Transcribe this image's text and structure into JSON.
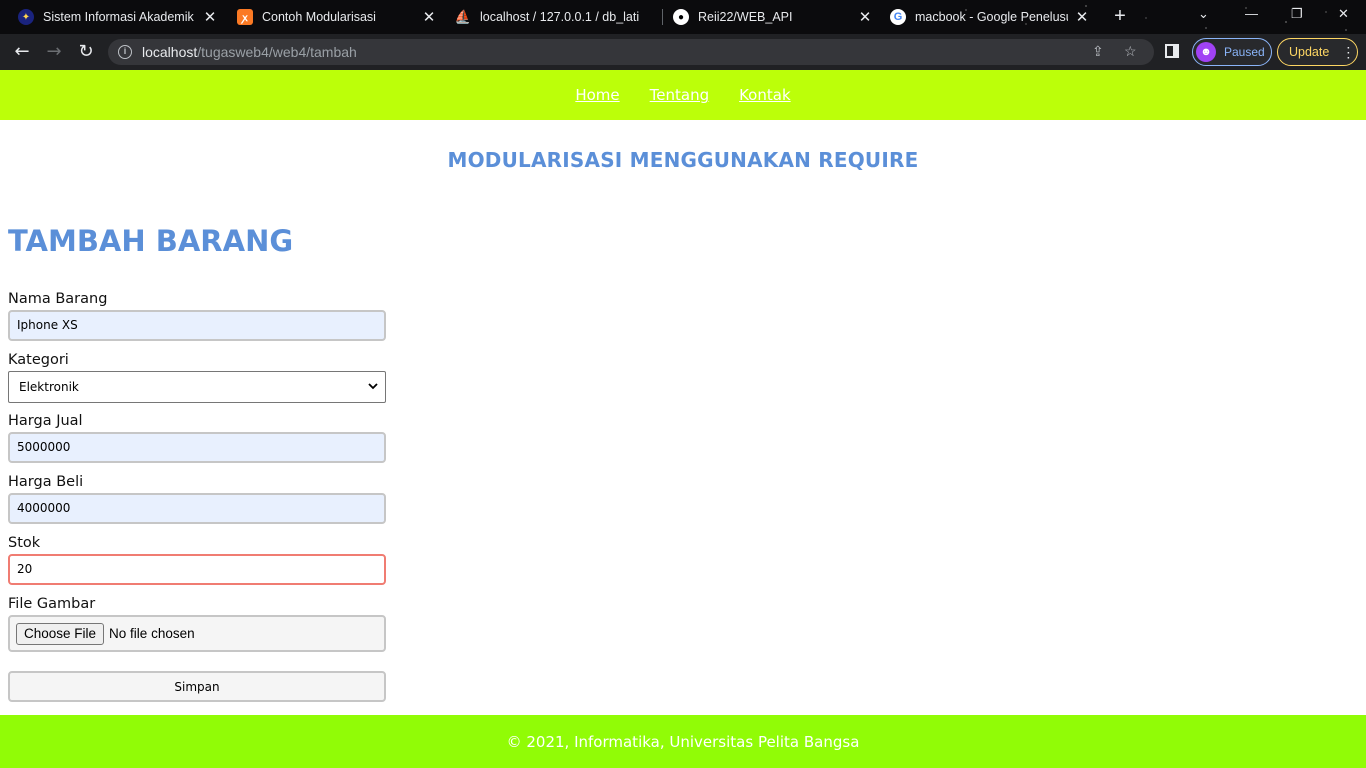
{
  "browser": {
    "tabs": [
      {
        "title": "Sistem Informasi Akademik",
        "icon": "university-logo-icon"
      },
      {
        "title": "Contoh Modularisasi",
        "icon": "xampp-icon"
      },
      {
        "title": "localhost / 127.0.0.1 / db_lati",
        "icon": "phpmyadmin-icon"
      },
      {
        "title": "Reii22/WEB_API",
        "icon": "github-icon"
      },
      {
        "title": "macbook - Google Penelusur",
        "icon": "google-icon"
      }
    ],
    "url_host": "localhost",
    "url_path": "/tugasweb4/web4/tambah",
    "profile_status": "Paused",
    "update_label": "Update"
  },
  "nav": {
    "items": [
      "Home",
      "Tentang",
      "Kontak"
    ]
  },
  "site_title": "MODULARISASI MENGGUNAKAN REQUIRE",
  "form": {
    "title": "TAMBAH BARANG",
    "nama_label": "Nama Barang",
    "nama_value": "Iphone XS",
    "kategori_label": "Kategori",
    "kategori_value": "Elektronik",
    "harga_jual_label": "Harga Jual",
    "harga_jual_value": "5000000",
    "harga_beli_label": "Harga Beli",
    "harga_beli_value": "4000000",
    "stok_label": "Stok",
    "stok_value": "20",
    "gambar_label": "File Gambar",
    "file_button": "Choose File",
    "file_status": "No file chosen",
    "submit_label": "Simpan"
  },
  "footer": {
    "text": "© 2021, Informatika, Universitas Pelita Bangsa"
  },
  "colors": {
    "nav_bg": "#bcff09",
    "footer_bg": "#91fc06",
    "heading": "#5b8fd8",
    "focus_border": "#f07c72"
  }
}
